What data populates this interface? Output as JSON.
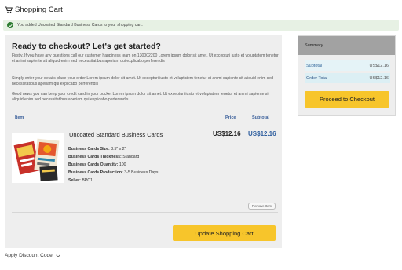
{
  "header": {
    "title": "Shopping Cart",
    "icon": "cart-icon"
  },
  "notice": {
    "text": "You added Uncoated Standard Business Cards to your shopping cart.",
    "icon": "check-icon",
    "color": "#2e7d32"
  },
  "checkout": {
    "heading": "Ready to checkout? Let's get started?",
    "paragraphs": [
      "Firstly, If you have any questions call our customer happiness team on 130002200 Lorem ipsum dolor sit amet. Ut excepturi iusto et voluptatem tenetur et animi sapiente sit aliquid enim sed necessitatibus aperiam qui explicabo perferendis",
      "Simply enter your details place your order Lorem ipsum dolor sit amet. Ut excepturi iusto et voluptatem tenetur et animi sapiente sit aliquid enim sed necessitatibus aperiam qui explicabo perferendis",
      "Good news you can keep your credit card in your pocket Lorem ipsum dolor sit amet. Ut excepturi iusto et voluptatem tenetur et animi sapiente sit aliquid enim sed necessitatibus aperiam qui explicabo perferendis"
    ]
  },
  "cart": {
    "columns": {
      "item": "Item",
      "price": "Price",
      "subtotal": "Subtotal"
    },
    "item": {
      "name": "Uncoated Standard Business Cards",
      "price": "US$12.16",
      "subtotal": "US$12.16",
      "specs": [
        {
          "label": "Business Cards Size:",
          "value": "3.5\" x 2\""
        },
        {
          "label": "Business Cards Thickness:",
          "value": "Standard"
        },
        {
          "label": "Business Cards Quantity:",
          "value": "100"
        },
        {
          "label": "Business Cards Production:",
          "value": "3-5 Business Days"
        },
        {
          "label": "Seller:",
          "value": "BPC1"
        }
      ],
      "remove_label": "Remove Item"
    },
    "update_label": "Update Shopping Cart"
  },
  "discount": {
    "label": "Apply Discount Code",
    "icon": "chevron-down-icon"
  },
  "summary": {
    "title": "Summary",
    "rows": [
      {
        "label": "Subtotal",
        "value": "US$12.16"
      },
      {
        "label": "Order Total",
        "value": "US$12.16"
      }
    ],
    "checkout_label": "Proceed to Checkout"
  },
  "colors": {
    "accent_button": "#f7c52b",
    "link_blue": "#3a5f9a",
    "summary_header": "#a2a2a2"
  }
}
